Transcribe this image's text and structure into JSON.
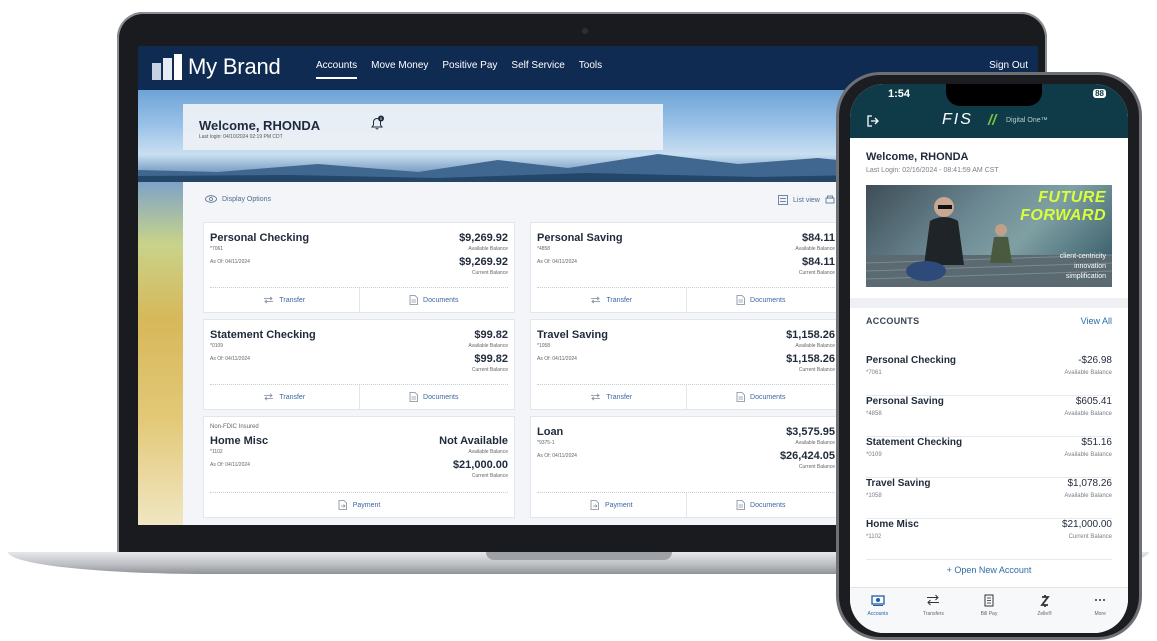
{
  "web": {
    "brand": "My Brand",
    "nav": [
      {
        "label": "Accounts",
        "active": true
      },
      {
        "label": "Move Money"
      },
      {
        "label": "Positive Pay"
      },
      {
        "label": "Self Service"
      },
      {
        "label": "Tools"
      }
    ],
    "sign_out": "Sign Out",
    "welcome": {
      "title": "Welcome, RHONDA",
      "last_login": "Last login: 04/10/2024 02:19 PM CDT",
      "notification_count": "0"
    },
    "toolbar": {
      "display_options": "Display Options",
      "list_view": "List view"
    },
    "accounts": [
      {
        "name": "Personal Checking",
        "num": "*7061",
        "asof": "As Of: 04/11/2024",
        "available": "$9,269.92",
        "available_label": "Available Balance",
        "current": "$9,269.92",
        "current_label": "Current Balance",
        "actions": [
          "Transfer",
          "Documents"
        ]
      },
      {
        "name": "Personal Saving",
        "num": "*4858",
        "asof": "As Of: 04/11/2024",
        "available": "$84.11",
        "available_label": "Available Balance",
        "current": "$84.11",
        "current_label": "Current Balance",
        "actions": [
          "Transfer",
          "Documents"
        ]
      },
      {
        "name": "Statement Checking",
        "num": "*0109",
        "asof": "As Of: 04/11/2024",
        "available": "$99.82",
        "available_label": "Available Balance",
        "current": "$99.82",
        "current_label": "Current Balance",
        "actions": [
          "Transfer",
          "Documents"
        ]
      },
      {
        "name": "Travel Saving",
        "num": "*1058",
        "asof": "As Of: 04/11/2024",
        "available": "$1,158.26",
        "available_label": "Available Balance",
        "current": "$1,158.26",
        "current_label": "Current Balance",
        "actions": [
          "Transfer",
          "Documents"
        ]
      },
      {
        "top_label": "Non-FDIC Insured",
        "name": "Home Misc",
        "num": "*1102",
        "asof": "As Of: 04/11/2024",
        "available": "Not Available",
        "available_label": "Available Balance",
        "current": "$21,000.00",
        "current_label": "Current Balance",
        "actions": [
          "Payment"
        ]
      },
      {
        "name": "Loan",
        "num": "*9375-1",
        "asof": "As Of: 04/11/2024",
        "available": "$3,575.95",
        "available_label": "Available Balance",
        "current": "$26,424.05",
        "current_label": "Current Balance",
        "actions": [
          "Payment",
          "Documents"
        ]
      }
    ]
  },
  "phone": {
    "time": "1:54",
    "battery": "88",
    "brand": "FIS",
    "brand_sub": "Digital One™",
    "welcome": "Welcome, RHONDA",
    "last_login": "Last Login: 02/16/2024 - 08:41:59 AM CST",
    "promo": {
      "line1": "FUTURE",
      "line2": "FORWARD",
      "tags": [
        "client-centricity",
        "innovation",
        "simplification"
      ]
    },
    "accounts_heading": "ACCOUNTS",
    "view_all": "View All",
    "accounts": [
      {
        "name": "Personal Checking",
        "num": "*7061",
        "amount": "-$26.98",
        "label": "Available Balance"
      },
      {
        "name": "Personal Saving",
        "num": "*4858",
        "amount": "$605.41",
        "label": "Available Balance"
      },
      {
        "name": "Statement Checking",
        "num": "*0109",
        "amount": "$51.16",
        "label": "Available Balance"
      },
      {
        "name": "Travel Saving",
        "num": "*1058",
        "amount": "$1,078.26",
        "label": "Available Balance"
      },
      {
        "name": "Home Misc",
        "num": "*1102",
        "amount": "$21,000.00",
        "label": "Current Balance"
      }
    ],
    "open_account": "+ Open New Account",
    "tabs": [
      {
        "label": "Accounts",
        "icon": "money-icon",
        "active": true
      },
      {
        "label": "Transfers",
        "icon": "transfer-icon"
      },
      {
        "label": "Bill Pay",
        "icon": "bill-icon"
      },
      {
        "label": "Zelle®",
        "icon": "zelle-icon"
      },
      {
        "label": "More",
        "icon": "more-icon"
      }
    ]
  }
}
